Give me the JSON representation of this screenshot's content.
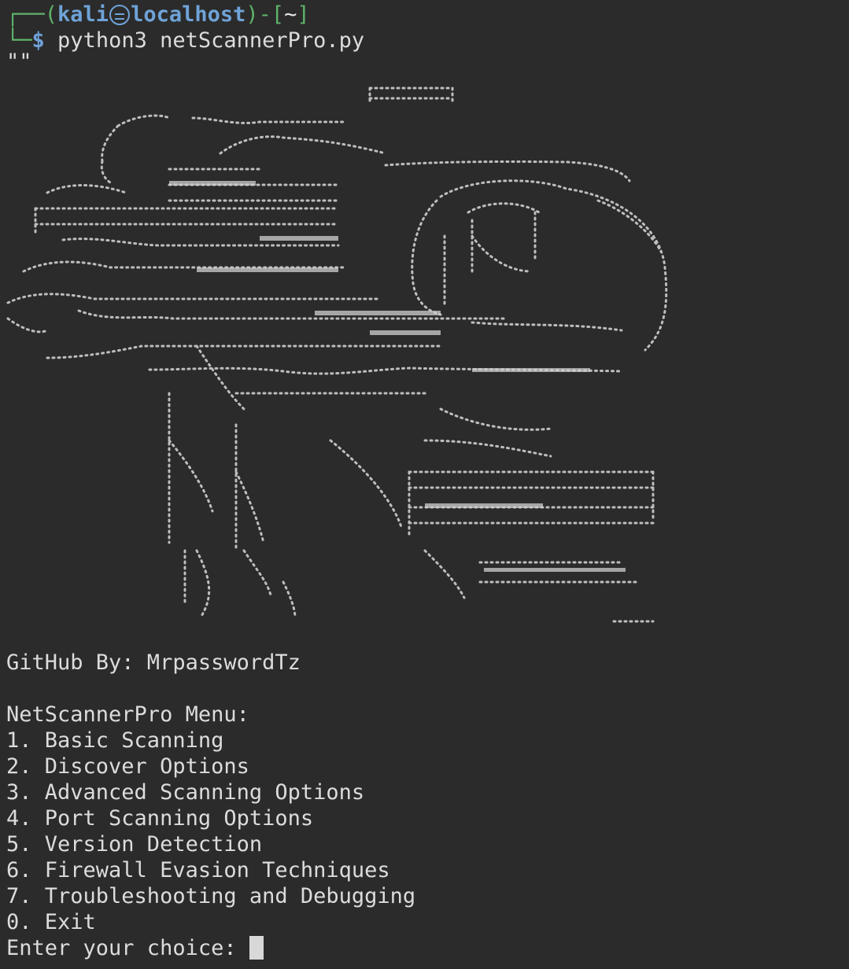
{
  "prompt": {
    "user": "kali",
    "host": "localhost",
    "cwd": "~",
    "symbol": "$",
    "command": "python3 netScannerPro.py"
  },
  "output_quote": "\"\"",
  "banner_icon": "braille-ascii-art-logo",
  "github_line": "GitHub By: MrpasswordTz",
  "menu": {
    "title": "NetScannerPro Menu:",
    "items": [
      "1. Basic Scanning",
      "2. Discover Options",
      "3. Advanced Scanning Options",
      "4. Port Scanning Options",
      "5. Version Detection",
      "6. Firewall Evasion Techniques",
      "7. Troubleshooting and Debugging",
      "0. Exit"
    ]
  },
  "input_prompt": "Enter your choice: ",
  "colors": {
    "background": "#2b2b2b",
    "text": "#dcdcdc",
    "prompt_green": "#5fb26a",
    "prompt_blue": "#6fa3d8"
  }
}
